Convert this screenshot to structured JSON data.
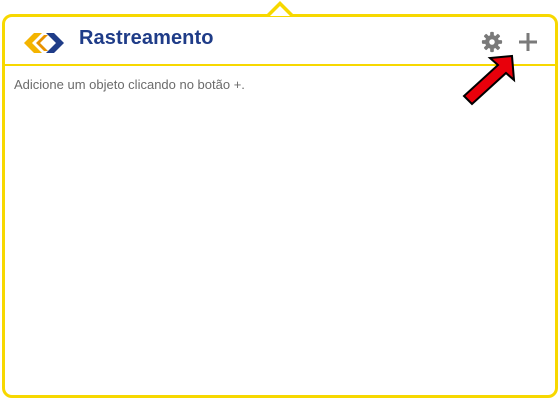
{
  "header": {
    "title": "Rastreamento",
    "logo_icon": "correios-logo-icon",
    "settings_icon": "gear-icon",
    "add_icon": "plus-icon"
  },
  "main": {
    "empty_message": "Adicione um objeto clicando no botão +."
  },
  "annotation": {
    "arrow_icon": "red-arrow-icon",
    "arrow_color": "#e8000b"
  },
  "colors": {
    "border": "#f7d800",
    "title": "#1f3c88",
    "logo_blue": "#1f3c88",
    "logo_yellow": "#f4b400",
    "icon_gray": "#7a7a7a"
  }
}
